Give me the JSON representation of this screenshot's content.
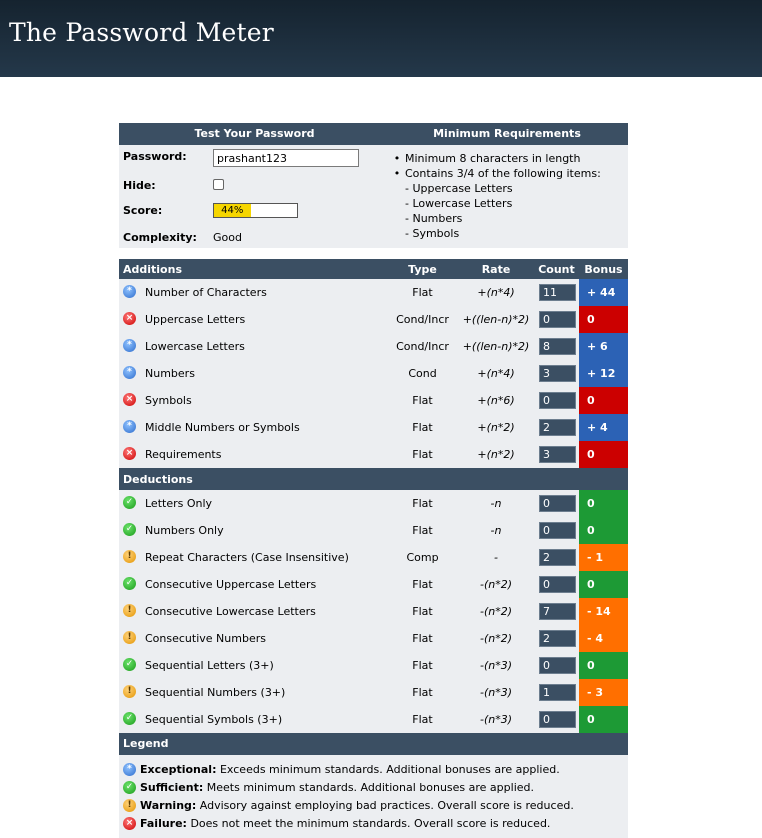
{
  "header": {
    "title": "The Password Meter"
  },
  "test": {
    "heading": "Test Your Password",
    "password_label": "Password:",
    "password_value": "prashant123",
    "hide_label": "Hide:",
    "score_label": "Score:",
    "score_text": "44%",
    "score_fraction": 0.44,
    "complexity_label": "Complexity:",
    "complexity_value": "Good"
  },
  "requirements": {
    "heading": "Minimum Requirements",
    "items": [
      {
        "bullet": "•",
        "text": "Minimum 8 characters in length"
      },
      {
        "bullet": "•",
        "text": "Contains 3/4 of the following items:"
      },
      {
        "bullet": "",
        "text": "- Uppercase Letters"
      },
      {
        "bullet": "",
        "text": "- Lowercase Letters"
      },
      {
        "bullet": "",
        "text": "- Numbers"
      },
      {
        "bullet": "",
        "text": "- Symbols"
      }
    ]
  },
  "columns": {
    "type": "Type",
    "rate": "Rate",
    "count": "Count",
    "bonus": "Bonus"
  },
  "additions": {
    "heading": "Additions",
    "rows": [
      {
        "icon": "exceptional-icon",
        "name": "Number of Characters",
        "type": "Flat",
        "rate": "+(n*4)",
        "count": "11",
        "bonus": "+ 44",
        "status": "blue"
      },
      {
        "icon": "failure-icon",
        "name": "Uppercase Letters",
        "type": "Cond/Incr",
        "rate": "+((len-n)*2)",
        "count": "0",
        "bonus": "0",
        "status": "red"
      },
      {
        "icon": "exceptional-icon",
        "name": "Lowercase Letters",
        "type": "Cond/Incr",
        "rate": "+((len-n)*2)",
        "count": "8",
        "bonus": "+ 6",
        "status": "blue"
      },
      {
        "icon": "exceptional-icon",
        "name": "Numbers",
        "type": "Cond",
        "rate": "+(n*4)",
        "count": "3",
        "bonus": "+ 12",
        "status": "blue"
      },
      {
        "icon": "failure-icon",
        "name": "Symbols",
        "type": "Flat",
        "rate": "+(n*6)",
        "count": "0",
        "bonus": "0",
        "status": "red"
      },
      {
        "icon": "exceptional-icon",
        "name": "Middle Numbers or Symbols",
        "type": "Flat",
        "rate": "+(n*2)",
        "count": "2",
        "bonus": "+ 4",
        "status": "blue"
      },
      {
        "icon": "failure-icon",
        "name": "Requirements",
        "type": "Flat",
        "rate": "+(n*2)",
        "count": "3",
        "bonus": "0",
        "status": "red"
      }
    ]
  },
  "deductions": {
    "heading": "Deductions",
    "rows": [
      {
        "icon": "sufficient-icon",
        "name": "Letters Only",
        "type": "Flat",
        "rate": "-n",
        "count": "0",
        "bonus": "0",
        "status": "green"
      },
      {
        "icon": "sufficient-icon",
        "name": "Numbers Only",
        "type": "Flat",
        "rate": "-n",
        "count": "0",
        "bonus": "0",
        "status": "green"
      },
      {
        "icon": "warning-icon",
        "name": "Repeat Characters (Case Insensitive)",
        "type": "Comp",
        "rate": "-",
        "count": "2",
        "bonus": "- 1",
        "status": "orange"
      },
      {
        "icon": "sufficient-icon",
        "name": "Consecutive Uppercase Letters",
        "type": "Flat",
        "rate": "-(n*2)",
        "count": "0",
        "bonus": "0",
        "status": "green"
      },
      {
        "icon": "warning-icon",
        "name": "Consecutive Lowercase Letters",
        "type": "Flat",
        "rate": "-(n*2)",
        "count": "7",
        "bonus": "- 14",
        "status": "orange"
      },
      {
        "icon": "warning-icon",
        "name": "Consecutive Numbers",
        "type": "Flat",
        "rate": "-(n*2)",
        "count": "2",
        "bonus": "- 4",
        "status": "orange"
      },
      {
        "icon": "sufficient-icon",
        "name": "Sequential Letters (3+)",
        "type": "Flat",
        "rate": "-(n*3)",
        "count": "0",
        "bonus": "0",
        "status": "green"
      },
      {
        "icon": "warning-icon",
        "name": "Sequential Numbers (3+)",
        "type": "Flat",
        "rate": "-(n*3)",
        "count": "1",
        "bonus": "- 3",
        "status": "orange"
      },
      {
        "icon": "sufficient-icon",
        "name": "Sequential Symbols (3+)",
        "type": "Flat",
        "rate": "-(n*3)",
        "count": "0",
        "bonus": "0",
        "status": "green"
      }
    ]
  },
  "legend": {
    "heading": "Legend",
    "items": [
      {
        "icon": "exceptional-icon",
        "status": "blue",
        "term": "Exceptional:",
        "desc": " Exceeds minimum standards. Additional bonuses are applied."
      },
      {
        "icon": "sufficient-icon",
        "status": "green",
        "term": "Sufficient:",
        "desc": " Meets minimum standards. Additional bonuses are applied."
      },
      {
        "icon": "warning-icon",
        "status": "orange",
        "term": "Warning:",
        "desc": " Advisory against employing bad practices. Overall score is reduced."
      },
      {
        "icon": "failure-icon",
        "status": "red",
        "term": "Failure:",
        "desc": " Does not meet the minimum standards. Overall score is reduced."
      }
    ]
  },
  "colors": {
    "header_bg": "#1b2b3a",
    "section_bar": "#3b4f63",
    "panel_bg": "#eceef1",
    "exceptional": "#2c62b5",
    "failure": "#cc0000",
    "sufficient": "#1d9a35",
    "warning": "#ff6f00",
    "score_fill": "#f6d600"
  }
}
